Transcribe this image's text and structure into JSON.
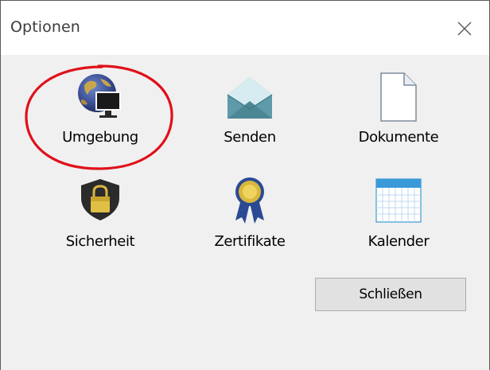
{
  "window": {
    "title": "Optionen",
    "close_icon": "close-icon"
  },
  "tiles": [
    {
      "label": "Umgebung",
      "icon": "globe-monitor-icon"
    },
    {
      "label": "Senden",
      "icon": "envelope-icon"
    },
    {
      "label": "Dokumente",
      "icon": "document-icon"
    },
    {
      "label": "Sicherheit",
      "icon": "shield-lock-icon"
    },
    {
      "label": "Zertifikate",
      "icon": "ribbon-award-icon"
    },
    {
      "label": "Kalender",
      "icon": "calendar-icon"
    }
  ],
  "annotation": {
    "highlight": "red-circle-highlight",
    "color": "#e0101a"
  },
  "buttons": {
    "close_label": "Schließen"
  }
}
